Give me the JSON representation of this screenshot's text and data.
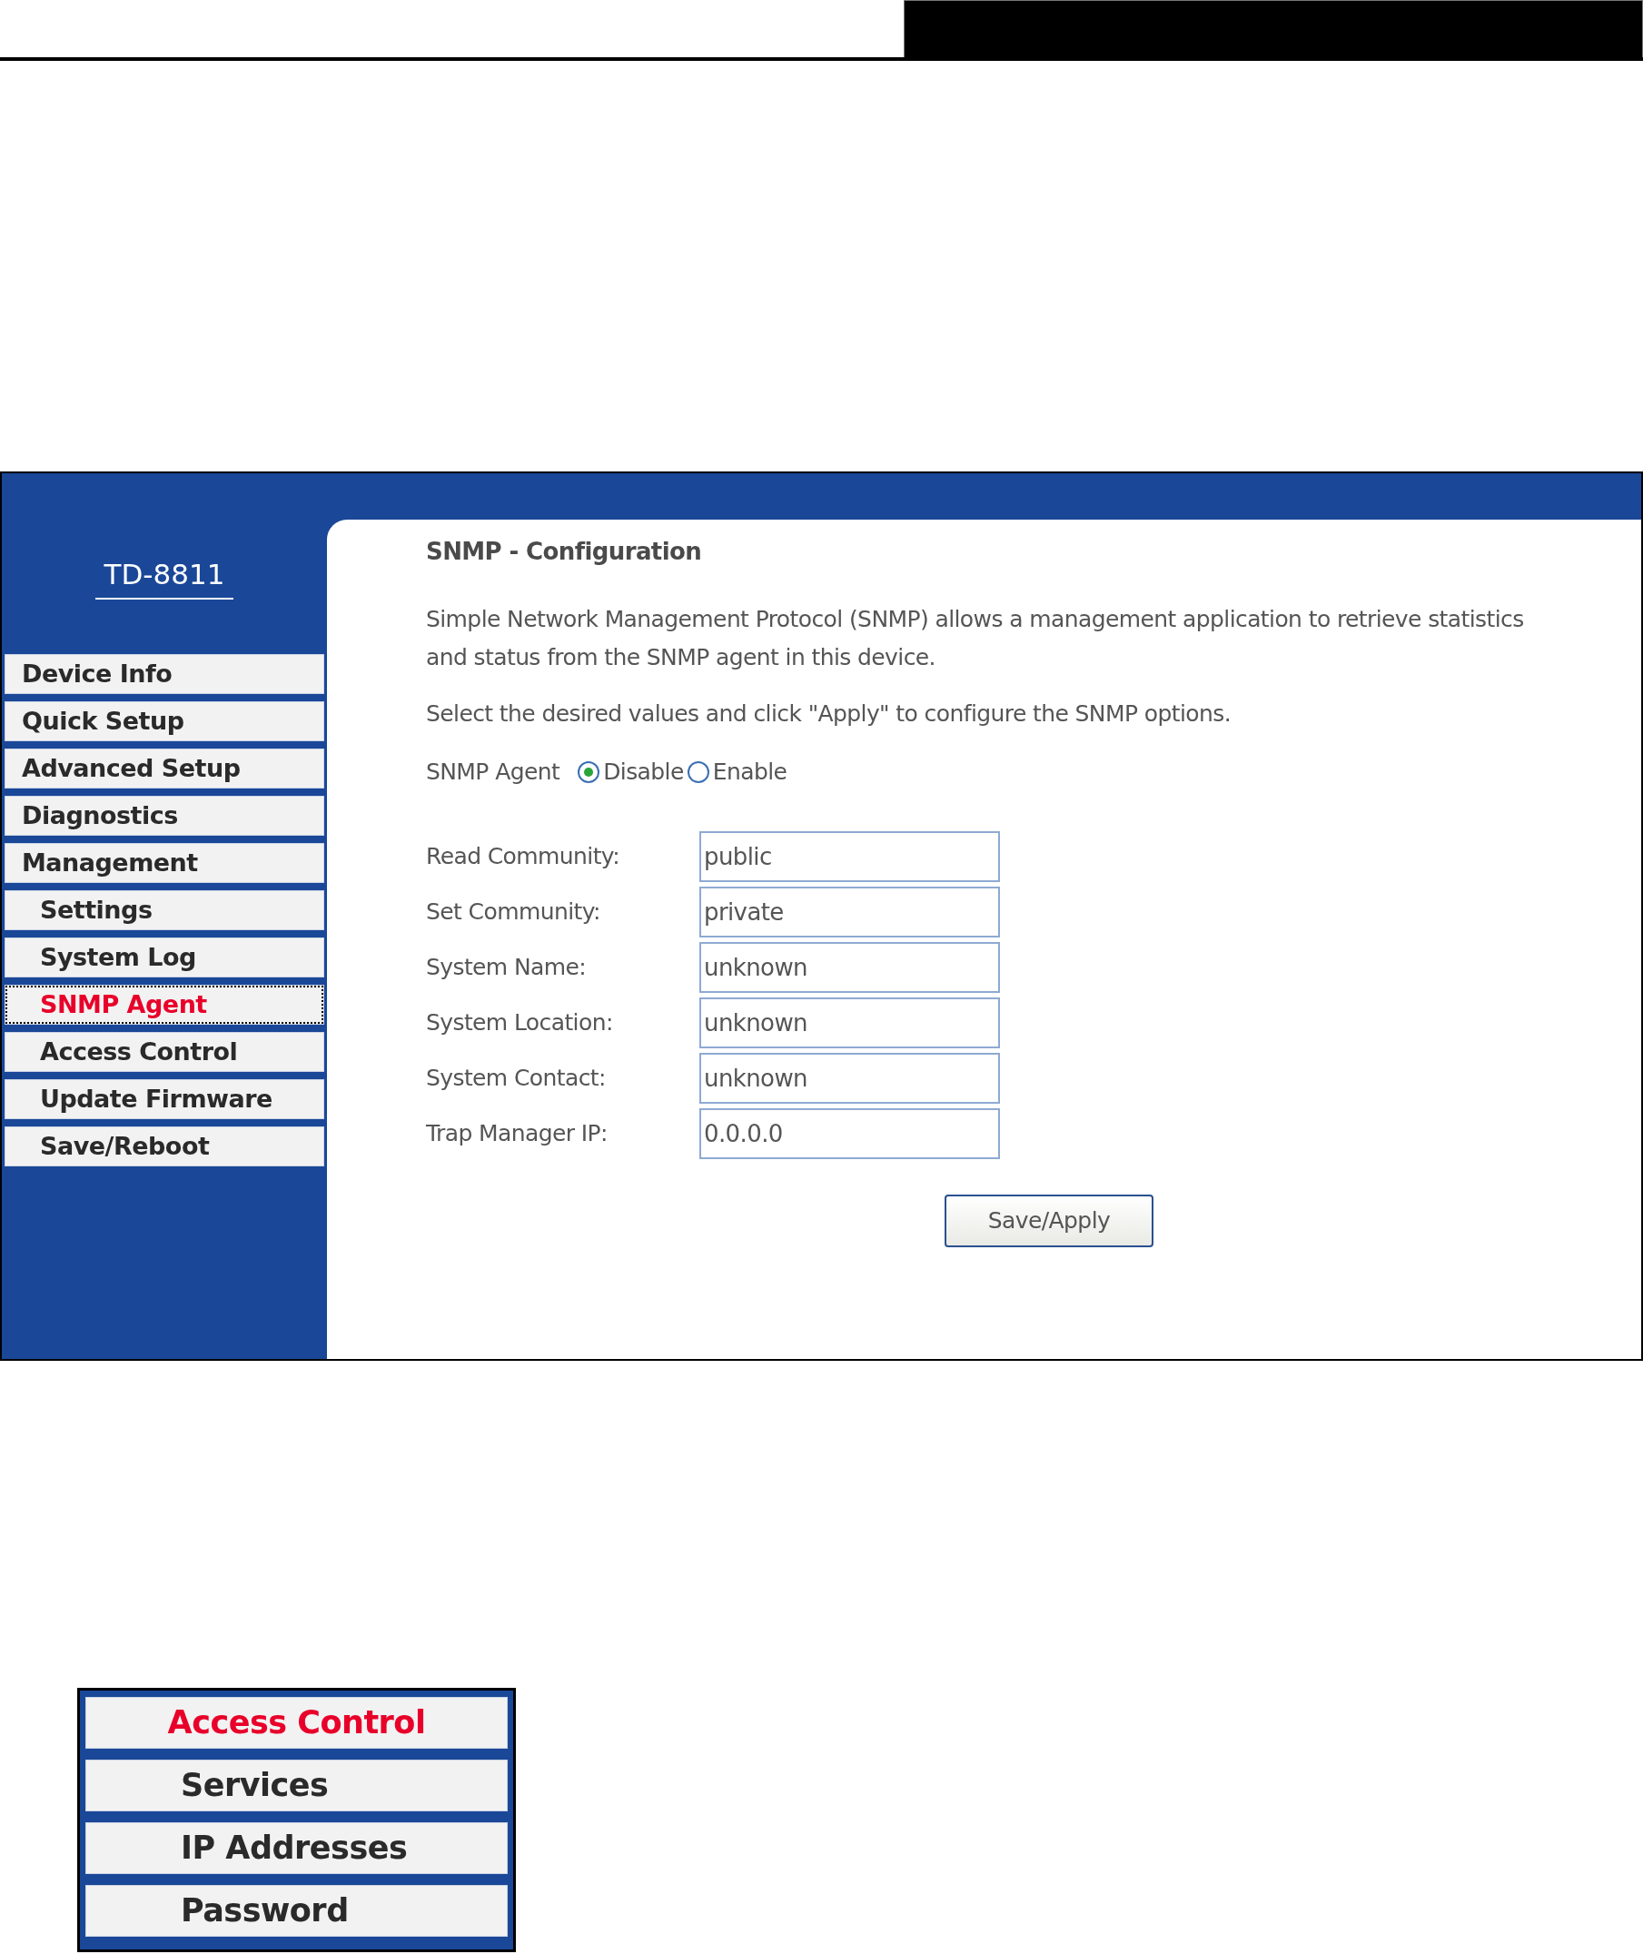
{
  "router": {
    "model": "TD-8811",
    "menu": [
      {
        "label": "Device Info",
        "selected": false
      },
      {
        "label": "Quick Setup",
        "selected": false
      },
      {
        "label": "Advanced Setup",
        "selected": false
      },
      {
        "label": "Diagnostics",
        "selected": false
      },
      {
        "label": "Management",
        "selected": false,
        "children": [
          {
            "label": "Settings",
            "selected": false
          },
          {
            "label": "System Log",
            "selected": false
          },
          {
            "label": "SNMP Agent",
            "selected": true
          },
          {
            "label": "Access Control",
            "selected": false
          },
          {
            "label": "Update Firmware",
            "selected": false
          },
          {
            "label": "Save/Reboot",
            "selected": false
          }
        ]
      }
    ]
  },
  "content": {
    "title": "SNMP - Configuration",
    "description": "Simple Network Management Protocol (SNMP) allows a management application to retrieve statistics and status from the SNMP agent in this device.",
    "instruction": "Select the desired values and click \"Apply\" to configure the SNMP options.",
    "snmp_agent": {
      "label": "SNMP Agent",
      "options": [
        {
          "label": "Disable",
          "selected": true
        },
        {
          "label": "Enable",
          "selected": false
        }
      ]
    },
    "fields": [
      {
        "label": "Read Community:",
        "value": "public"
      },
      {
        "label": "Set Community:",
        "value": "private"
      },
      {
        "label": "System Name:",
        "value": "unknown"
      },
      {
        "label": "System Location:",
        "value": "unknown"
      },
      {
        "label": "System Contact:",
        "value": "unknown"
      },
      {
        "label": "Trap Manager IP:",
        "value": "0.0.0.0"
      }
    ],
    "button": "Save/Apply"
  },
  "submenu": {
    "label": "Access Control",
    "selected": true,
    "children": [
      {
        "label": "Services",
        "selected": false
      },
      {
        "label": "IP Addresses",
        "selected": false
      },
      {
        "label": "Password",
        "selected": false
      }
    ]
  }
}
